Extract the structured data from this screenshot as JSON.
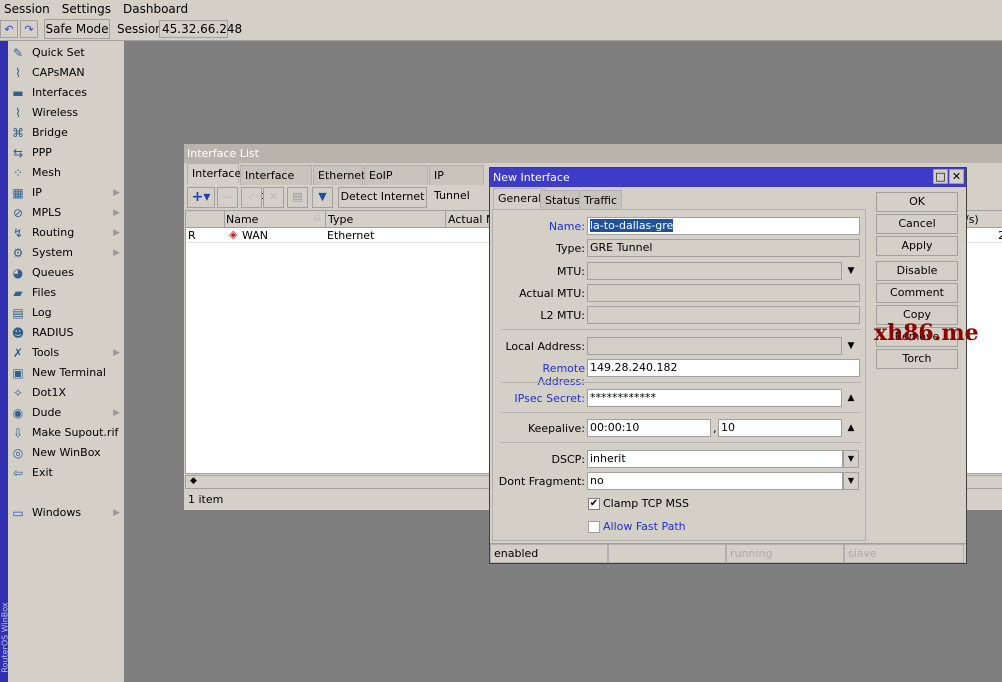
{
  "menubar": {
    "items": [
      "Session",
      "Settings",
      "Dashboard"
    ]
  },
  "toolbar": {
    "undo": "undo-icon",
    "redo": "redo-icon",
    "safe_mode": "Safe Mode",
    "session_label": "Session:",
    "session_value": "45.32.66.248"
  },
  "sidebar": {
    "vertical_text": "RouterOS WinBox",
    "items": [
      {
        "label": "Quick Set",
        "icon": "✎",
        "sub": false
      },
      {
        "label": "CAPsMAN",
        "icon": "⌇",
        "sub": false
      },
      {
        "label": "Interfaces",
        "icon": "▬",
        "sub": false
      },
      {
        "label": "Wireless",
        "icon": "⌇",
        "sub": false
      },
      {
        "label": "Bridge",
        "icon": "⌘",
        "sub": false
      },
      {
        "label": "PPP",
        "icon": "⇆",
        "sub": false
      },
      {
        "label": "Mesh",
        "icon": "⁘",
        "sub": false
      },
      {
        "label": "IP",
        "icon": "▦",
        "sub": true
      },
      {
        "label": "MPLS",
        "icon": "⊘",
        "sub": true
      },
      {
        "label": "Routing",
        "icon": "↯",
        "sub": true
      },
      {
        "label": "System",
        "icon": "⚙",
        "sub": true
      },
      {
        "label": "Queues",
        "icon": "◕",
        "sub": false
      },
      {
        "label": "Files",
        "icon": "▰",
        "sub": false
      },
      {
        "label": "Log",
        "icon": "▤",
        "sub": false
      },
      {
        "label": "RADIUS",
        "icon": "☻",
        "sub": false
      },
      {
        "label": "Tools",
        "icon": "✗",
        "sub": true
      },
      {
        "label": "New Terminal",
        "icon": "▣",
        "sub": false
      },
      {
        "label": "Dot1X",
        "icon": "✧",
        "sub": false
      },
      {
        "label": "Dude",
        "icon": "◉",
        "sub": true
      },
      {
        "label": "Make Supout.rif",
        "icon": "⇩",
        "sub": false
      },
      {
        "label": "New WinBox",
        "icon": "◎",
        "sub": false
      },
      {
        "label": "Exit",
        "icon": "⇦",
        "sub": false
      }
    ],
    "windows": "Windows"
  },
  "interface_list": {
    "title": "Interface List",
    "tabs": [
      "Interface",
      "Interface List",
      "Ethernet",
      "EoIP Tunnel",
      "IP Tunnel"
    ],
    "detect_internet": "Detect Internet",
    "columns": [
      "",
      "Name",
      "Type",
      "Actual MT",
      "/s)"
    ],
    "rows": [
      {
        "flag": "R",
        "name": "WAN",
        "type": "Ethernet",
        "extra": "2"
      }
    ],
    "status": "1 item"
  },
  "dialog": {
    "title": "New Interface",
    "tabs": [
      "General",
      "Status",
      "Traffic"
    ],
    "fields": {
      "name": {
        "label": "Name:",
        "value": "la-to-dallas-gre"
      },
      "type": {
        "label": "Type:",
        "value": "GRE Tunnel"
      },
      "mtu": {
        "label": "MTU:",
        "value": ""
      },
      "actual_mtu": {
        "label": "Actual MTU:",
        "value": ""
      },
      "l2_mtu": {
        "label": "L2 MTU:",
        "value": ""
      },
      "local_address": {
        "label": "Local Address:",
        "value": ""
      },
      "remote_address": {
        "label": "Remote Address:",
        "value": "149.28.240.182"
      },
      "ipsec_secret": {
        "label": "IPsec Secret:",
        "value": "************"
      },
      "keepalive": {
        "label": "Keepalive:",
        "value1": "00:00:10",
        "value2": "10"
      },
      "dscp": {
        "label": "DSCP:",
        "value": "inherit"
      },
      "dont_fragment": {
        "label": "Dont Fragment:",
        "value": "no"
      },
      "clamp_tcp_mss": {
        "label": "Clamp TCP MSS",
        "checked": true
      },
      "allow_fast_path": {
        "label": "Allow Fast Path",
        "checked": false
      }
    },
    "buttons": [
      "OK",
      "Cancel",
      "Apply",
      "Disable",
      "Comment",
      "Copy",
      "Remove",
      "Torch"
    ],
    "status": [
      "enabled",
      "",
      "running",
      "slave"
    ]
  },
  "watermark": "xh86.me",
  "colors": {
    "title_active": "#3c3cc8",
    "desktop": "#7f7f7f",
    "panel": "#d4d0c8",
    "link_label": "#2030d0",
    "watermark": "#8b0000"
  }
}
